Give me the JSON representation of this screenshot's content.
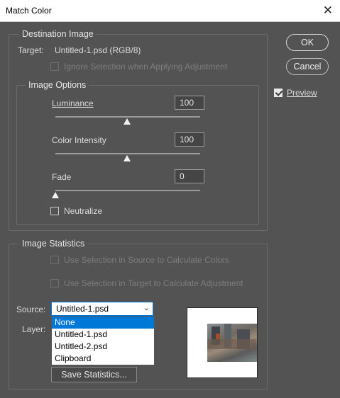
{
  "window": {
    "title": "Match Color",
    "close_glyph": "✕"
  },
  "buttons": {
    "ok": "OK",
    "cancel": "Cancel"
  },
  "preview": {
    "label": "Preview",
    "checked": true
  },
  "destination": {
    "legend": "Destination Image",
    "target_label": "Target:",
    "target_value": "Untitled-1.psd (RGB/8)",
    "ignore_selection": "Ignore Selection when Applying Adjustment"
  },
  "image_options": {
    "legend": "Image Options",
    "luminance": {
      "label": "Luminance",
      "value": "100",
      "slider_level": 0.5
    },
    "color_intensity": {
      "label": "Color Intensity",
      "value": "100",
      "slider_level": 0.5
    },
    "fade": {
      "label": "Fade",
      "value": "0",
      "slider_level": 0.0
    },
    "neutralize": "Neutralize"
  },
  "statistics": {
    "legend": "Image Statistics",
    "use_source": "Use Selection in Source to Calculate Colors",
    "use_target": "Use Selection in Target to Calculate Adjustment",
    "source_label": "Source:",
    "source_value": "Untitled-1.psd",
    "layer_label": "Layer:",
    "dropdown_options": [
      "None",
      "Untitled-1.psd",
      "Untitled-2.psd",
      "Clipboard"
    ],
    "selected_option": "None",
    "save_statistics": "Save Statistics..."
  }
}
